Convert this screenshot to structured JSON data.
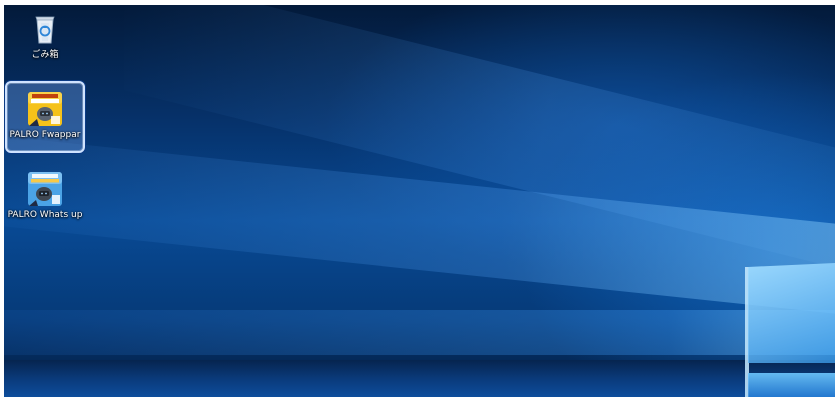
{
  "desktop": {
    "icons": [
      {
        "label": "ごみ箱",
        "icon": "recycle-bin-icon",
        "selected": false
      },
      {
        "label": "PALRO Fwappar",
        "icon": "palro-fwappar-app-icon",
        "selected": true,
        "badge_text": "PALRO Fwappar"
      },
      {
        "label": "PALRO Whats up",
        "icon": "palro-whats-up-app-icon",
        "selected": false,
        "badge_text": "PALRO Whats up"
      }
    ]
  },
  "colors": {
    "wallpaper_dark": "#031a3a",
    "wallpaper_accent": "#1478dc",
    "selection_border": "#cfe3ff",
    "fwappar_icon": "#f5c21a",
    "whatsup_icon": "#4ba3e6"
  }
}
